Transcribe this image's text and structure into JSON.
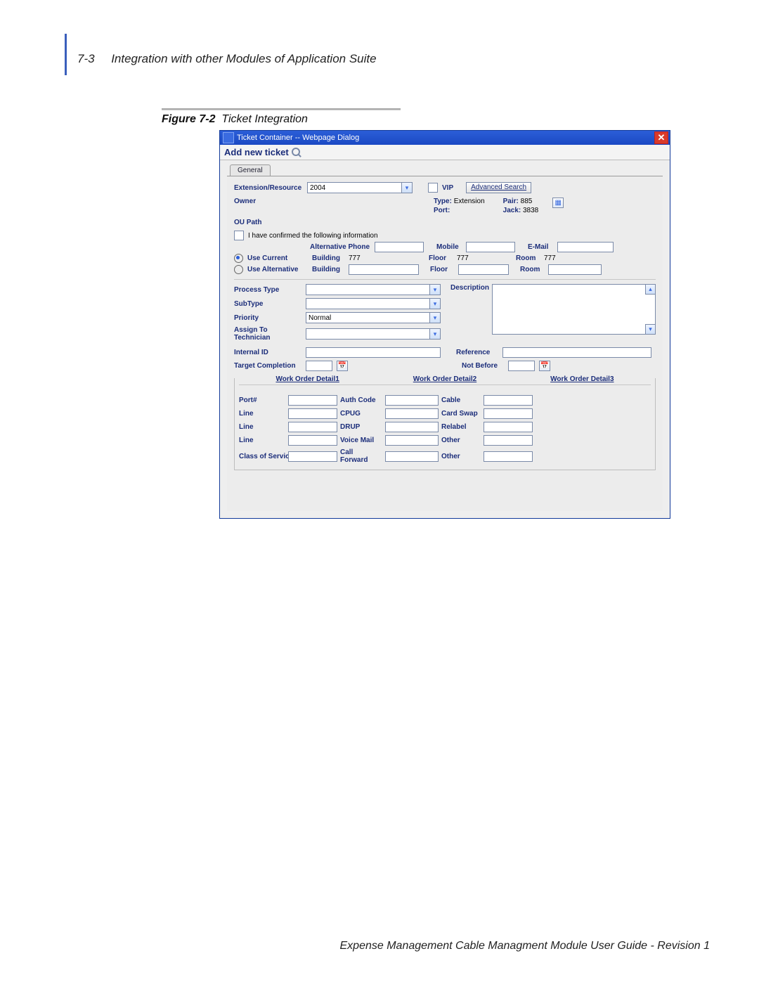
{
  "header": {
    "page_num": "7-3",
    "section_title": "Integration with other Modules of Application Suite"
  },
  "figure_caption": {
    "label": "Figure 7-2",
    "title": "Ticket Integration"
  },
  "dialog": {
    "window_title": "Ticket Container -- Webpage Dialog",
    "close_glyph": "✕",
    "subheader": "Add new ticket",
    "tab_general": "General",
    "ext_res_label": "Extension/Resource",
    "ext_res_value": "2004",
    "vip_label": "VIP",
    "adv_search": "Advanced Search",
    "owner_label": "Owner",
    "type_label": "Type:",
    "type_value": "Extension",
    "port_label": "Port:",
    "port_value": "",
    "pair_label": "Pair:",
    "pair_value": "885",
    "jack_label": "Jack:",
    "jack_value": "3838",
    "ou_path_label": "OU Path",
    "confirm_label": "I have confirmed the following information",
    "alt_phone_label": "Alternative Phone",
    "mobile_label": "Mobile",
    "email_label": "E-Mail",
    "use_current_label": "Use Current",
    "use_alt_label": "Use Alternative",
    "building_label": "Building",
    "building_cur": "777",
    "floor_label": "Floor",
    "floor_cur": "777",
    "room_label": "Room",
    "room_cur": "777",
    "process_type_label": "Process Type",
    "subtype_label": "SubType",
    "priority_label": "Priority",
    "priority_value": "Normal",
    "assign_label": "Assign To Technician",
    "desc_label": "Description",
    "internal_id_label": "Internal ID",
    "reference_label": "Reference",
    "target_label": "Target Completion",
    "not_before_label": "Not Before",
    "wo_head1": "Work Order Detail1",
    "wo_head2": "Work Order Detail2",
    "wo_head3": "Work Order Detail3",
    "wo": {
      "port": "Port#",
      "authcode": "Auth Code",
      "cable": "Cable",
      "line": "Line",
      "cpug": "CPUG",
      "cardswap": "Card Swap",
      "drup": "DRUP",
      "relabel": "Relabel",
      "voicemail": "Voice Mail",
      "other": "Other",
      "cos": "Class of Service",
      "callfwd": "Call Forward"
    }
  },
  "footer": "Expense Management Cable Managment Module User Guide - Revision 1"
}
